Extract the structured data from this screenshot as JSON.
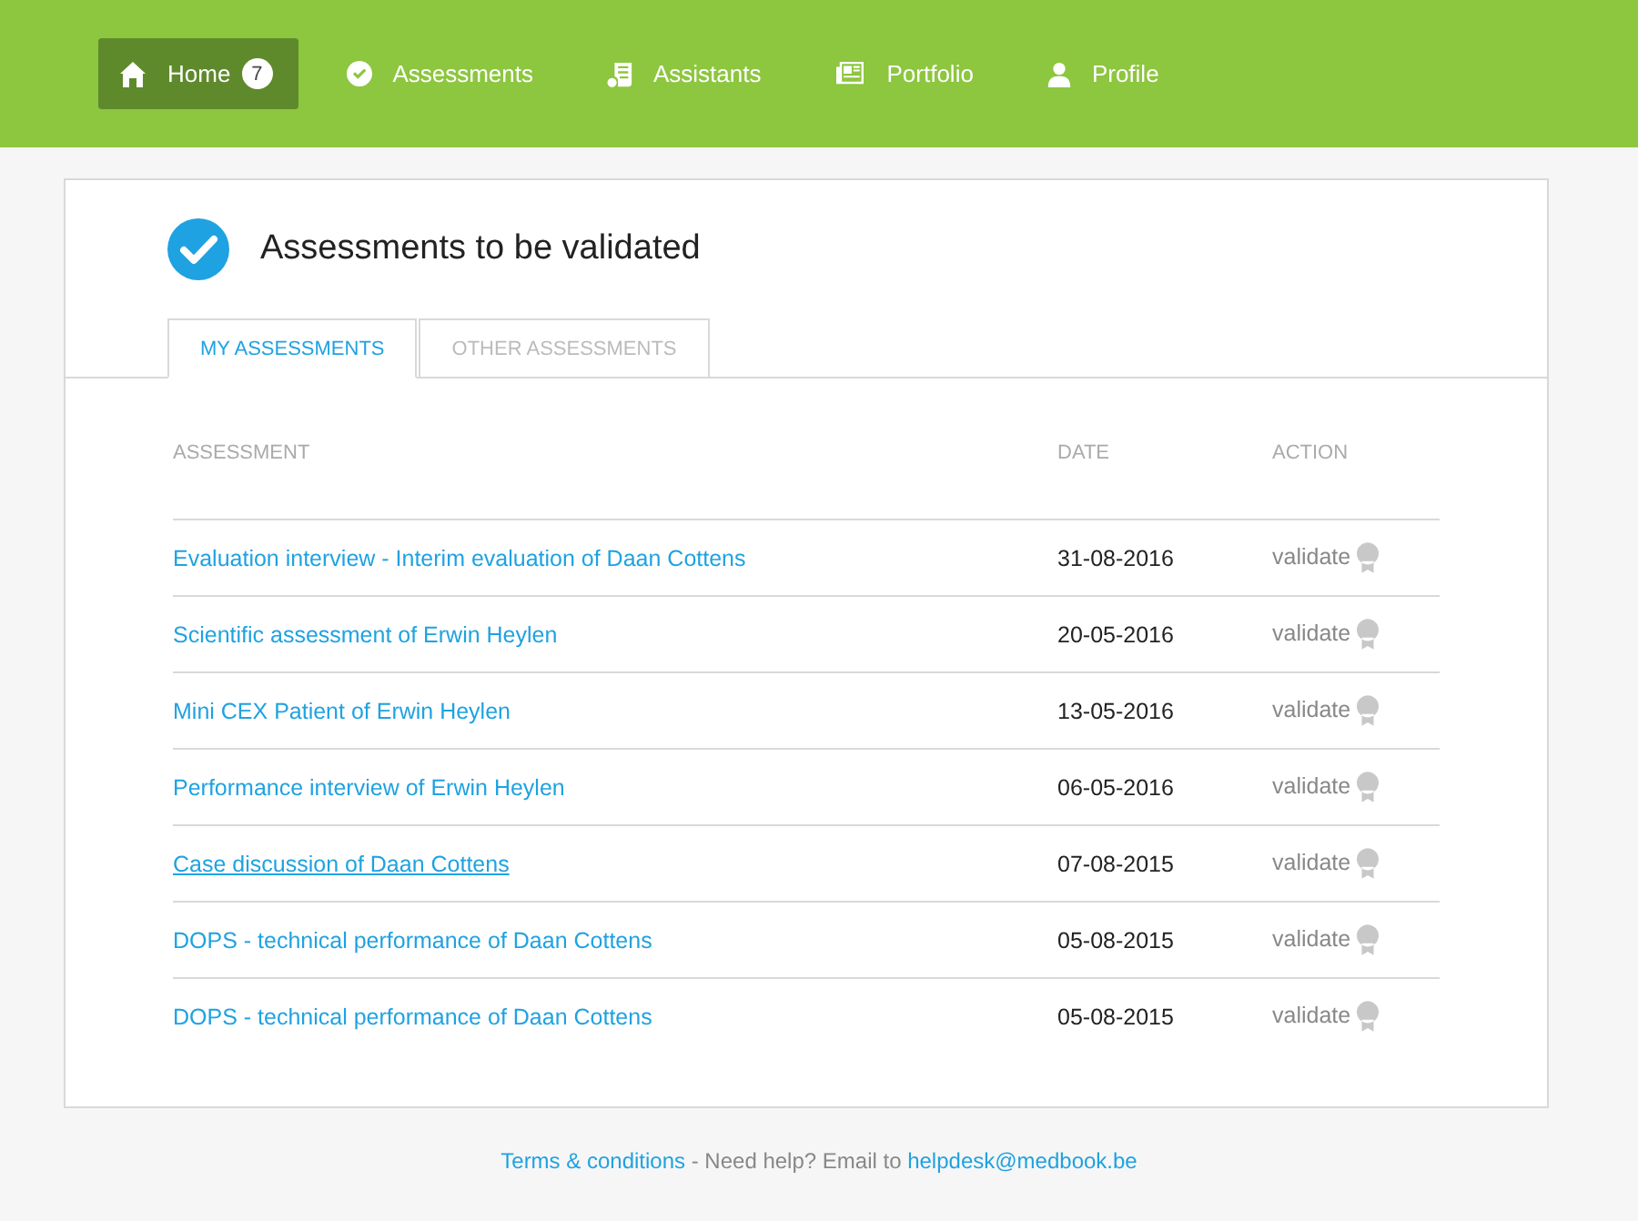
{
  "nav": [
    {
      "kind": "home",
      "label": "Home",
      "badge": "7",
      "selected": true
    },
    {
      "kind": "check",
      "label": "Assessments",
      "selected": false
    },
    {
      "kind": "document",
      "label": "Assistants",
      "selected": false
    },
    {
      "kind": "newspaper",
      "label": "Portfolio",
      "selected": false
    },
    {
      "kind": "person",
      "label": "Profile",
      "selected": false
    }
  ],
  "title": "Assessments to be validated",
  "tabs": [
    {
      "label": "MY ASSESSMENTS",
      "selected": true
    },
    {
      "label": "OTHER ASSESSMENTS",
      "selected": false
    }
  ],
  "table": {
    "columns": [
      "ASSESSMENT",
      "DATE",
      "ACTION"
    ],
    "rows": [
      {
        "assessment": "Evaluation interview - Interim evaluation of Daan Cottens",
        "date": "31-08-2016",
        "action": "validate",
        "hovered": false
      },
      {
        "assessment": "Scientific assessment of Erwin Heylen",
        "date": "20-05-2016",
        "action": "validate",
        "hovered": false
      },
      {
        "assessment": "Mini CEX Patient of Erwin Heylen",
        "date": "13-05-2016",
        "action": "validate",
        "hovered": false
      },
      {
        "assessment": "Performance interview of Erwin Heylen",
        "date": "06-05-2016",
        "action": "validate",
        "hovered": false
      },
      {
        "assessment": "Case discussion of Daan Cottens",
        "date": "07-08-2015",
        "action": "validate",
        "hovered": true
      },
      {
        "assessment": "DOPS - technical performance of Daan Cottens",
        "date": "05-08-2015",
        "action": "validate",
        "hovered": false
      },
      {
        "assessment": "DOPS - technical performance of Daan Cottens",
        "date": "05-08-2015",
        "action": "validate",
        "hovered": false
      }
    ]
  },
  "footer": {
    "terms": "Terms & conditions",
    "text": " - Need help? Email to ",
    "email": "helpdesk@medbook.be"
  }
}
